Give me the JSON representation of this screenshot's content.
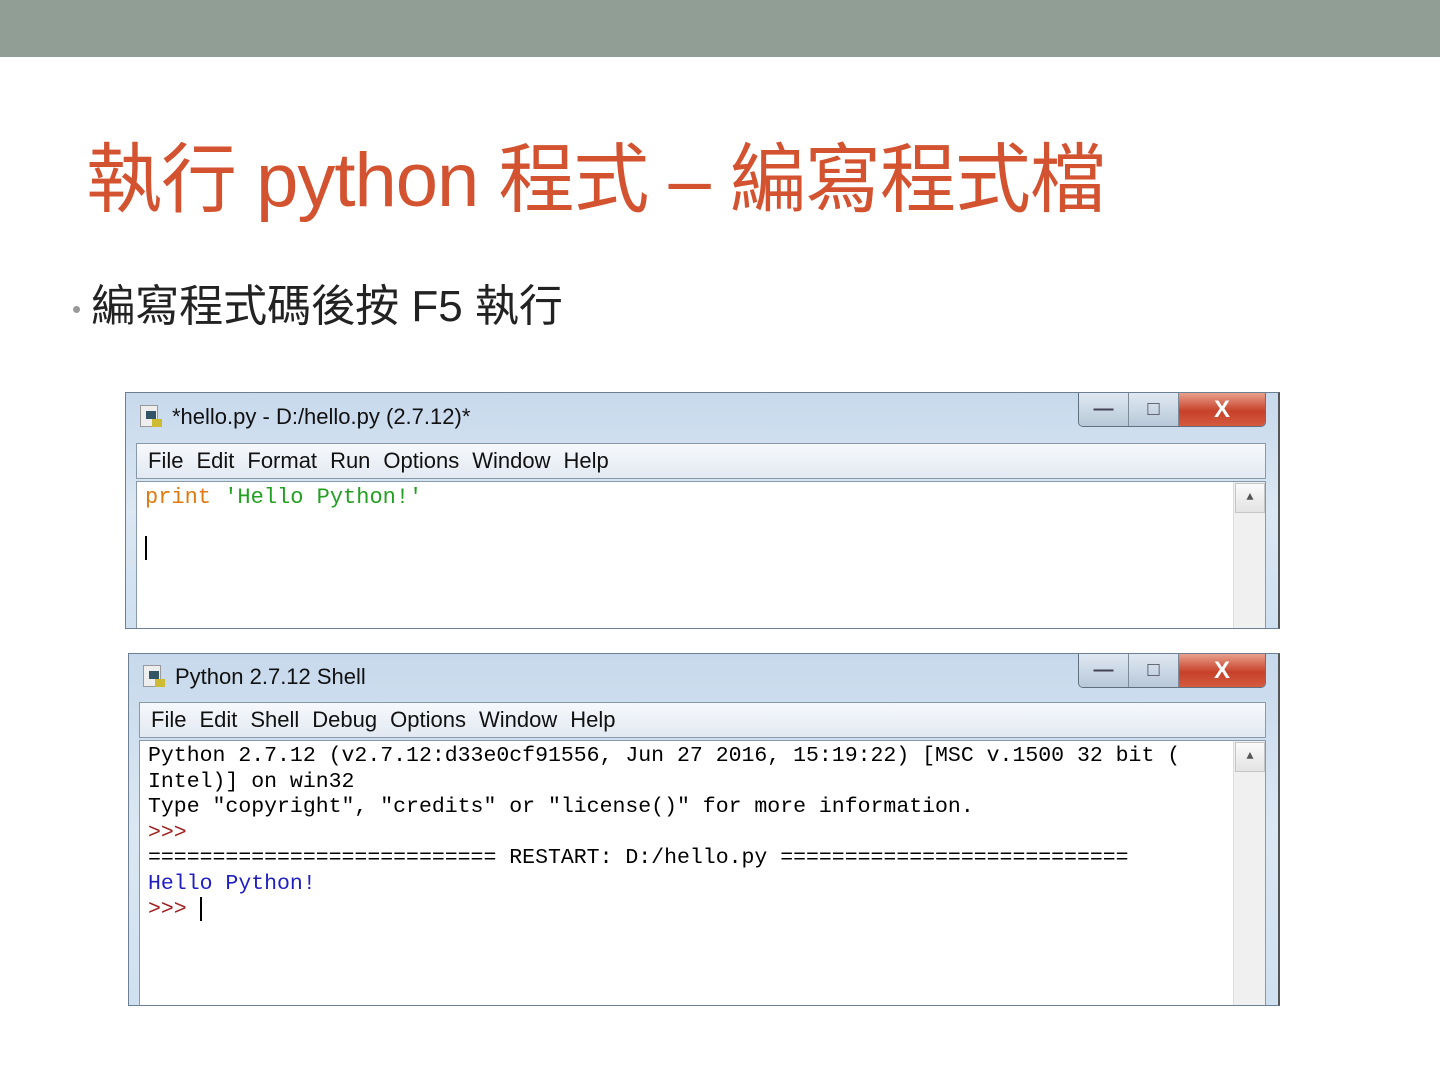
{
  "slide": {
    "title": "執行 python 程式 – 編寫程式檔",
    "bullet": "編寫程式碼後按 F5 執行"
  },
  "editor_window": {
    "title": "*hello.py - D:/hello.py (2.7.12)*",
    "menu": [
      "File",
      "Edit",
      "Format",
      "Run",
      "Options",
      "Window",
      "Help"
    ],
    "code": {
      "keyword": "print",
      "string": "'Hello Python!'"
    }
  },
  "shell_window": {
    "title": "Python 2.7.12 Shell",
    "menu": [
      "File",
      "Edit",
      "Shell",
      "Debug",
      "Options",
      "Window",
      "Help"
    ],
    "lines": {
      "l1": "Python 2.7.12 (v2.7.12:d33e0cf91556, Jun 27 2016, 15:19:22) [MSC v.1500 32 bit (",
      "l2": "Intel)] on win32",
      "l3": "Type \"copyright\", \"credits\" or \"license()\" for more information.",
      "prompt": ">>>",
      "restart": "=========================== RESTART: D:/hello.py ===========================",
      "output": "Hello Python!"
    }
  },
  "window_controls": {
    "minimize": "—",
    "maximize": "□",
    "close": "X"
  }
}
